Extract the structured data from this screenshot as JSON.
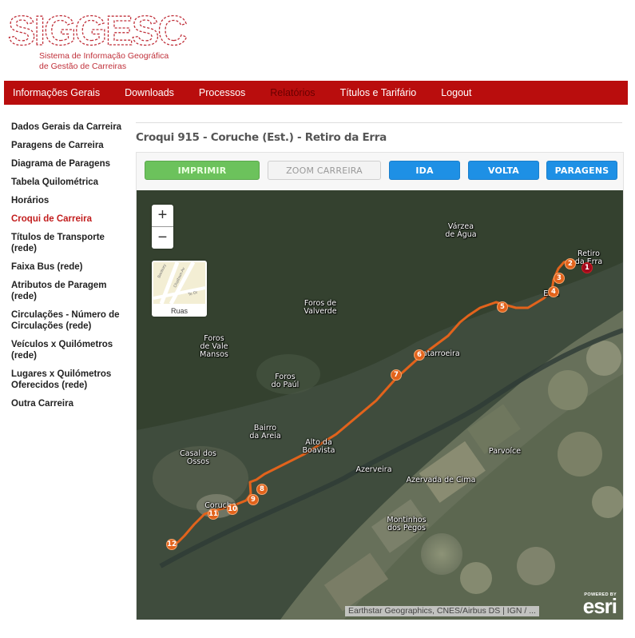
{
  "logo": {
    "acronym": "SIGGESC",
    "subtitle_line1": "Sistema de Informação Geográfica",
    "subtitle_line2": "de Gestão de Carreiras"
  },
  "nav": {
    "items": [
      {
        "label": "Informações Gerais",
        "active": false
      },
      {
        "label": "Downloads",
        "active": false
      },
      {
        "label": "Processos",
        "active": false
      },
      {
        "label": "Relatórios",
        "active": true
      },
      {
        "label": "Títulos e Tarifário",
        "active": false
      },
      {
        "label": "Logout",
        "active": false
      }
    ]
  },
  "sidebar": {
    "items": [
      {
        "label": "Dados Gerais da Carreira",
        "active": false
      },
      {
        "label": "Paragens de Carreira",
        "active": false
      },
      {
        "label": "Diagrama de Paragens",
        "active": false
      },
      {
        "label": "Tabela Quilométrica",
        "active": false
      },
      {
        "label": "Horários",
        "active": false
      },
      {
        "label": "Croqui de Carreira",
        "active": true
      },
      {
        "label": "Títulos de Transporte (rede)",
        "active": false
      },
      {
        "label": "Faixa Bus (rede)",
        "active": false
      },
      {
        "label": "Atributos de Paragem (rede)",
        "active": false
      },
      {
        "label": "Circulações - Número de Circulações (rede)",
        "active": false
      },
      {
        "label": "Veículos x Quilómetros (rede)",
        "active": false
      },
      {
        "label": "Lugares x Quilómetros Oferecidos (rede)",
        "active": false
      },
      {
        "label": "Outra Carreira",
        "active": false
      }
    ]
  },
  "page": {
    "title": "Croqui 915 - Coruche (Est.) - Retiro da Erra"
  },
  "toolbar": {
    "print_label": "IMPRIMIR",
    "zoom_label": "ZOOM CARREIRA",
    "ida_label": "IDA",
    "volta_label": "VOLTA",
    "paragens_label": "PARAGENS"
  },
  "map": {
    "zoom_in": "+",
    "zoom_out": "−",
    "basemap_label": "Ruas",
    "basemap_streets": [
      "Banbury",
      "Chatham Av",
      "Te Dr"
    ],
    "attribution": "Earthstar Geographics, CNES/Airbus DS | IGN / ...",
    "esri_powered": "POWERED BY",
    "esri_name": "esri",
    "route_color": "#e2631c",
    "places": [
      {
        "name": "Várzea\nde Água"
      },
      {
        "name": "Retiro\nda Erra"
      },
      {
        "name": "Erra"
      },
      {
        "name": "Foros de\nValverde"
      },
      {
        "name": "Foros\nde Vale\nMansos"
      },
      {
        "name": "Catarroeira"
      },
      {
        "name": "Foros\ndo Paúl"
      },
      {
        "name": "Bairro\nda Areia"
      },
      {
        "name": "Alto da\nBoavista"
      },
      {
        "name": "Casal dos\nOssos"
      },
      {
        "name": "Parvoíce"
      },
      {
        "name": "Azerveira"
      },
      {
        "name": "Azervada de Cima"
      },
      {
        "name": "Coruche"
      },
      {
        "name": "Montinhos\ndos Pegos"
      }
    ],
    "stops": [
      "1",
      "2",
      "3",
      "4",
      "5",
      "6",
      "7",
      "8",
      "9",
      "10",
      "11",
      "12"
    ]
  }
}
